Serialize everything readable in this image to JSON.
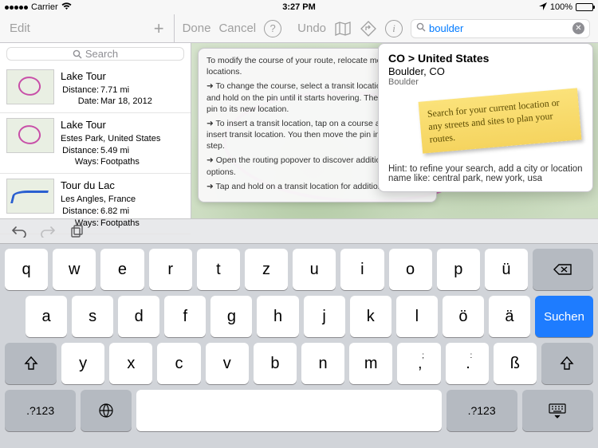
{
  "status": {
    "carrier": "Carrier",
    "wifi_icon": "wifi",
    "time": "3:27 PM",
    "battery_pct": "100%"
  },
  "sidebar_top": {
    "edit": "Edit",
    "add_icon": "plus"
  },
  "main_top": {
    "done": "Done",
    "cancel": "Cancel",
    "help_icon": "?",
    "undo": "Undo",
    "map_icon": "map",
    "diamond_icon": "diamond",
    "info_icon": "i",
    "search_icon": "search",
    "search_value": "boulder",
    "clear_icon": "x"
  },
  "sidebar_search": {
    "placeholder": "Search"
  },
  "routes": [
    {
      "title": "Lake Tour",
      "line1_label": "Distance:",
      "line1_val": "7.71 mi",
      "line2_label": "Date:",
      "line2_val": "Mar 18, 2012",
      "thumb": "pink"
    },
    {
      "title": "Lake Tour",
      "subtitle": "Estes Park, United States",
      "line1_label": "Distance:",
      "line1_val": "5.49 mi",
      "line2_label": "Ways:",
      "line2_val": "Footpaths",
      "thumb": "pink"
    },
    {
      "title": "Tour du Lac",
      "subtitle": "Les Angles, France",
      "line1_label": "Distance:",
      "line1_val": "6.82 mi",
      "line2_label": "Ways:",
      "line2_val": "Footpaths",
      "thumb": "blue"
    }
  ],
  "help_popover": {
    "intro": "To modify the course of your route, relocate more transit locations.",
    "b1": "➜ To change the course, select a transit location. Then tap and hold on the pin until it starts hovering. Then move the pin to its new location.",
    "b2": "➜ To insert a transit location, tap on a course and choose insert transit location. You then move the pin in a second step.",
    "b3": "➜ Open the routing popover to discover additional routing options.",
    "b4": "➜ Tap and hold on a transit location for additional options."
  },
  "search_popover": {
    "breadcrumb": "CO > United States",
    "result_main": "Boulder, CO",
    "result_sub": "Boulder",
    "sticky_note": "Search for your current location or any streets and sites to plan your routes.",
    "hint": "Hint: to refine your search, add a city or location name like: central park, new york, usa"
  },
  "undo_bar": {
    "undo_icon": "undo",
    "redo_icon": "redo",
    "copy_icon": "copy"
  },
  "keyboard": {
    "row1": [
      "q",
      "w",
      "e",
      "r",
      "t",
      "z",
      "u",
      "i",
      "o",
      "p",
      "ü"
    ],
    "row2": [
      "a",
      "s",
      "d",
      "f",
      "g",
      "h",
      "j",
      "k",
      "l",
      "ö",
      "ä"
    ],
    "row3_mid": [
      "y",
      "x",
      "c",
      "v",
      "b",
      "n",
      "m"
    ],
    "row3_punct": [
      ",",
      ".",
      "ß"
    ],
    "row3_punct_sup": [
      ";",
      ":",
      ""
    ],
    "backspace": "⌫",
    "shift": "⇧",
    "search_key": "Suchen",
    "numkey": ".?123",
    "globe": "globe",
    "dismiss": "keyboard-hide"
  }
}
